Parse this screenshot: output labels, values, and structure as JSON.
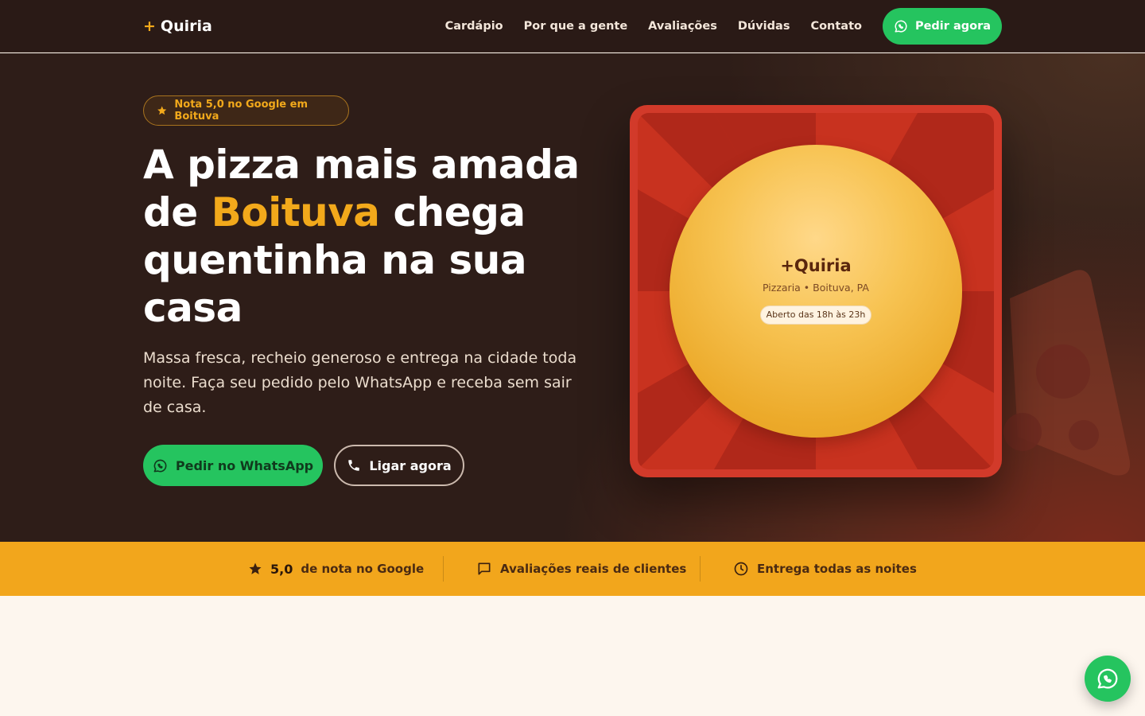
{
  "nav": {
    "logo_plus": "+",
    "logo_text": "Quiria",
    "links": [
      "Cardápio",
      "Por que a gente",
      "Avaliações",
      "Dúvidas",
      "Contato"
    ],
    "cta_label": "Pedir agora"
  },
  "hero": {
    "badge": "Nota 5,0 no Google em Boituva",
    "headline_1": "A pizza mais amada de ",
    "headline_accent": "Boituva",
    "headline_2": " chega quentinha na sua casa",
    "subtitle": "Massa fresca, recheio generoso e entrega na cidade toda noite. Faça seu pedido pelo WhatsApp e receba sem sair de casa.",
    "btn_whatsapp": "Pedir no WhatsApp",
    "btn_call": "Ligar agora"
  },
  "card": {
    "brand": "+Quiria",
    "subtitle": "Pizzaria • Boituva, PA",
    "hours": "Aberto das 18h às 23h"
  },
  "strip": {
    "rating_value": "5,0",
    "rating_label": "de nota no Google",
    "reviews_label": "Avaliações reais de clientes",
    "delivery_label": "Entrega todas as noites"
  },
  "colors": {
    "accent": "#f2a91b",
    "whatsapp_green": "#25c45f",
    "hero_bg": "#2e1d18",
    "card_red": "#d23a2a"
  },
  "icons": [
    "star-icon",
    "whatsapp-icon",
    "phone-icon",
    "chat-icon",
    "clock-icon"
  ]
}
